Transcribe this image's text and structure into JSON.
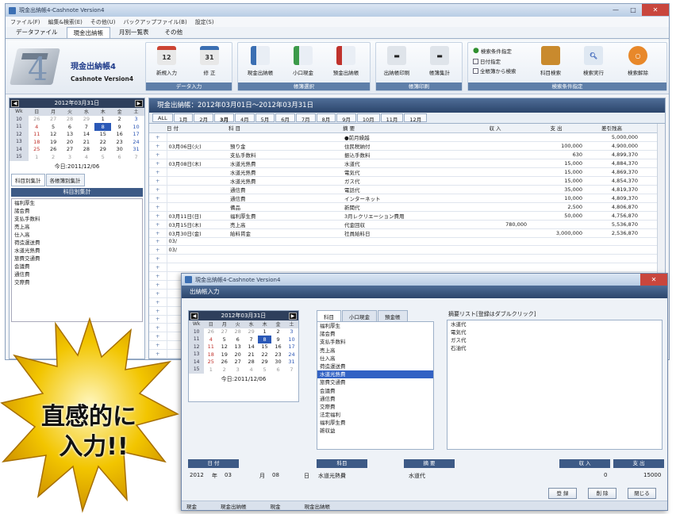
{
  "app": {
    "title": "現金出納帳4-Cashnote Version4",
    "menu": [
      "ファイル(F)",
      "編集&検索(E)",
      "その他(U)",
      "バックアップファイル(B)",
      "設定(S)"
    ],
    "tabs": [
      "データファイル",
      "現金出納帳",
      "月別一覧表",
      "その他"
    ]
  },
  "logo": {
    "title": "現金出納帳4",
    "subtitle": "Cashnote Version4",
    "numeral": "4"
  },
  "ribbon": {
    "groups": [
      "データ入力",
      "帳簿選択",
      "帳簿印刷",
      "検索条件指定"
    ],
    "buttons": [
      {
        "label": "新規入力",
        "glyph": "12"
      },
      {
        "label": "修 正",
        "glyph": "31"
      },
      {
        "label": "現金出納帳"
      },
      {
        "label": "小口現金"
      },
      {
        "label": "預金出納帳"
      },
      {
        "label": "出納帳印刷"
      },
      {
        "label": "帳簿集計"
      },
      {
        "label": "科目検索"
      },
      {
        "label": "検索実行"
      },
      {
        "label": "検索解除"
      }
    ],
    "checks": [
      "検索条件指定",
      "日付指定",
      "全帳簿から検索"
    ]
  },
  "calendar": {
    "title": "2012年03月31日",
    "headers": [
      "Wk",
      "日",
      "月",
      "火",
      "水",
      "木",
      "金",
      "土"
    ],
    "rows": [
      [
        "10",
        "26",
        "27",
        "28",
        "29",
        "1",
        "2",
        "3"
      ],
      [
        "11",
        "4",
        "5",
        "6",
        "7",
        "8",
        "9",
        "10"
      ],
      [
        "12",
        "11",
        "12",
        "13",
        "14",
        "15",
        "16",
        "17"
      ],
      [
        "13",
        "18",
        "19",
        "20",
        "21",
        "22",
        "23",
        "24"
      ],
      [
        "14",
        "25",
        "26",
        "27",
        "28",
        "29",
        "30",
        "31"
      ],
      [
        "15",
        "1",
        "2",
        "3",
        "4",
        "5",
        "6",
        "7"
      ]
    ],
    "today": "今日:2011/12/06"
  },
  "left_tabs": [
    "科目別集計",
    "各帳簿別集計"
  ],
  "left_header": "科目別集計",
  "accounts": [
    "福利厚生",
    "諸会費",
    "支払手数料",
    "売上高",
    "仕入高",
    "荷造運送費",
    "水道光熱費",
    "旅費交通費",
    "会議費",
    "通信費",
    "交際費"
  ],
  "ledger": {
    "title": "現金出納帳：2012年03月01日～2012年03月31日",
    "months": [
      "ALL",
      "1月",
      "2月",
      "3月",
      "4月",
      "5月",
      "6月",
      "7月",
      "8月",
      "9月",
      "10月",
      "11月",
      "12月"
    ],
    "columns": [
      "日 付",
      "科 目",
      "摘 要",
      "収 入",
      "支 出",
      "差引残高"
    ],
    "rows": [
      [
        "",
        "",
        "●前月繰越",
        "",
        "",
        "5,000,000"
      ],
      [
        "03月06日(火)",
        "預り金",
        "住民税納付",
        "",
        "100,000",
        "4,900,000"
      ],
      [
        "",
        "支払手数料",
        "振込手数料",
        "",
        "630",
        "4,899,370"
      ],
      [
        "03月08日(木)",
        "水道光熱費",
        "水道代",
        "",
        "15,000",
        "4,884,370"
      ],
      [
        "",
        "水道光熱費",
        "電気代",
        "",
        "15,000",
        "4,869,370"
      ],
      [
        "",
        "水道光熱費",
        "ガス代",
        "",
        "15,000",
        "4,854,370"
      ],
      [
        "",
        "通信費",
        "電話代",
        "",
        "35,000",
        "4,819,370"
      ],
      [
        "",
        "通信費",
        "インターネット",
        "",
        "10,000",
        "4,809,370"
      ],
      [
        "",
        "備品",
        "新聞代",
        "",
        "2,500",
        "4,806,870"
      ],
      [
        "03月11日(日)",
        "福利厚生費",
        "3月レクリエーション費用",
        "",
        "50,000",
        "4,756,870"
      ],
      [
        "03月15日(木)",
        "売上高",
        "代金回収",
        "780,000",
        "",
        "5,536,870"
      ],
      [
        "03月30日(金)",
        "給料賃金",
        "社員給料日",
        "",
        "3,000,000",
        "2,536,870"
      ],
      [
        "03/",
        "",
        "",
        "",
        "",
        ""
      ],
      [
        "03/",
        "",
        "",
        "",
        "",
        ""
      ]
    ]
  },
  "dialog": {
    "title": "現金出納帳4-Cashnote Version4",
    "header": "出納帳入力",
    "tabs": [
      "科目",
      "小口現金",
      "預金帳"
    ],
    "accounts": [
      "福利厚生",
      "諸会費",
      "支払手数料",
      "売上高",
      "仕入高",
      "荷造運送費",
      "水道光熱費",
      "旅費交通費",
      "会議費",
      "通信費",
      "交際費",
      "法定福利",
      "福利厚生費",
      "雑収益"
    ],
    "selected": "水道光熱費",
    "desc_label": "摘要リスト[登録はダブルクリック]",
    "descs": [
      "水道代",
      "電気代",
      "ガス代",
      "石油代"
    ],
    "labels": [
      "日 付",
      "科目",
      "摘 要",
      "収 入",
      "支 出"
    ],
    "entry": {
      "year": "2012",
      "year_unit": "年",
      "month": "03",
      "month_unit": "月",
      "day": "08",
      "day_unit": "日",
      "account": "水道光熱費",
      "desc": "水道代",
      "income": "0",
      "expense": "15000"
    },
    "buttons": [
      "登 録",
      "削 除",
      "閉じる"
    ],
    "status": [
      "現金",
      "現金出納帳",
      "現金",
      "現金出納帳"
    ]
  },
  "burst": {
    "line1": "直感的に",
    "line2": "入力!!"
  }
}
